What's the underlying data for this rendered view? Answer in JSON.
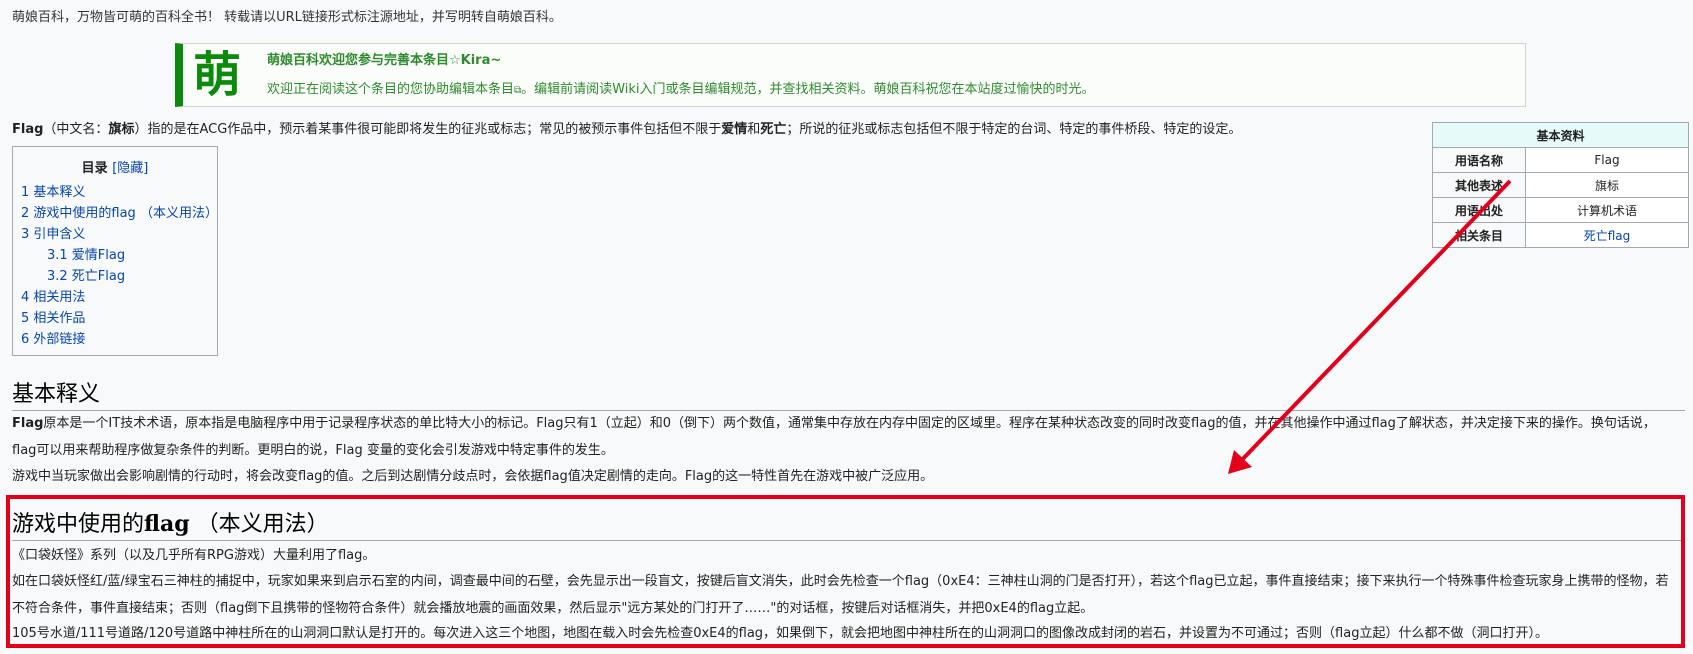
{
  "notice": "萌娘百科，万物皆可萌的百科全书！ 转载请以URL链接形式标注源地址，并写明转自萌娘百科。",
  "welcome": {
    "logo": "萌",
    "title": "萌娘百科欢迎您参与完善本条目☆Kira~",
    "body_1": "欢迎正在阅读这个条目的您协助",
    "link_edit": "编辑本条目",
    "body_2": "。编辑前请阅读",
    "link_wiki": "Wiki入门",
    "body_3": "或",
    "link_rules": "条目编辑规范",
    "body_4": "，并查找相关资料。萌娘百科祝您在本站度过愉快的时光。"
  },
  "intro": {
    "term": "Flag",
    "cn_open": "（中文名：",
    "cn_name": "旗标",
    "text_1": "）指的是在ACG作品中，预示着某事件很可能即将发生的征兆或标志；常见的被预示事件包括但不限于",
    "love": "爱情",
    "and": "和",
    "death": "死亡",
    "text_2": "；所说的征兆或标志包括但不限于特定的台词、特定的事件桥段、特定的设定。"
  },
  "toc": {
    "title": "目录",
    "hide_label": "[隐藏]",
    "items": [
      {
        "label": "1 基本释义"
      },
      {
        "label": "2 游戏中使用的flag （本义用法）"
      },
      {
        "label": "3 引申含义"
      },
      {
        "label": "3.1 爱情Flag"
      },
      {
        "label": "3.2 死亡Flag"
      },
      {
        "label": "4 相关用法"
      },
      {
        "label": "5 相关作品"
      },
      {
        "label": "6 外部链接"
      }
    ]
  },
  "infobox": {
    "title": "基本资料",
    "rows": [
      {
        "label": "用语名称",
        "value": "Flag"
      },
      {
        "label": "其他表述",
        "value": "旗标"
      },
      {
        "label": "用语出处",
        "value": "计算机术语"
      },
      {
        "label": "相关条目",
        "value": "死亡flag"
      }
    ]
  },
  "section_basic": {
    "heading": "基本释义",
    "p1_term": "Flag",
    "p1_text": "原本是一个IT技术术语，原本指是电脑程序中用于记录程序状态的单比特大小的标记。Flag只有1（立起）和0（倒下）两个数值，通常集中存放在内存中固定的区域里。程序在某种状态改变的同时改变flag的值，并在其他操作中通过flag了解状态，并决定接下来的操作。换句话说，flag可以用来帮助程序做复杂条件的判断。更明白的说，Flag 变量的变化会引发游戏中特定事件的发生。",
    "p2": "游戏中当玩家做出会影响剧情的行动时，将会改变flag的值。之后到达剧情分歧点时，会依据flag值决定剧情的走向。Flag的这一特性首先在游戏中被广泛应用。"
  },
  "section_game": {
    "heading_1": "游戏中使用的",
    "heading_flag": "flag",
    "heading_2": "（本义用法）",
    "p1": "《口袋妖怪》系列（以及几乎所有RPG游戏）大量利用了flag。",
    "p2": "如在口袋妖怪红/蓝/绿宝石三神柱的捕捉中，玩家如果来到启示石室的内间，调查最中间的石壁，会先显示出一段盲文，按键后盲文消失，此时会先检查一个flag（0xE4：三神柱山洞的门是否打开），若这个flag已立起，事件直接结束；接下来执行一个特殊事件检查玩家身上携带的怪物，若不符合条件，事件直接结束；否则（flag倒下且携带的怪物符合条件）就会播放地震的画面效果，然后显示\"远方某处的门打开了……\"的对话框，按键后对话框消失，并把0xE4的flag立起。",
    "p3": "105号水道/111号道路/120号道路中神柱所在的山洞洞口默认是打开的。每次进入这三个地图，地图在载入时会先检查0xE4的flag，如果倒下，就会把地图中神柱所在的山洞洞口的图像改成封闭的岩石，并设置为不可通过；否则（flag立起）什么都不做（洞口打开）。"
  },
  "annotation": {
    "box_color": "#e3001b",
    "arrow_color": "#e3001b"
  }
}
